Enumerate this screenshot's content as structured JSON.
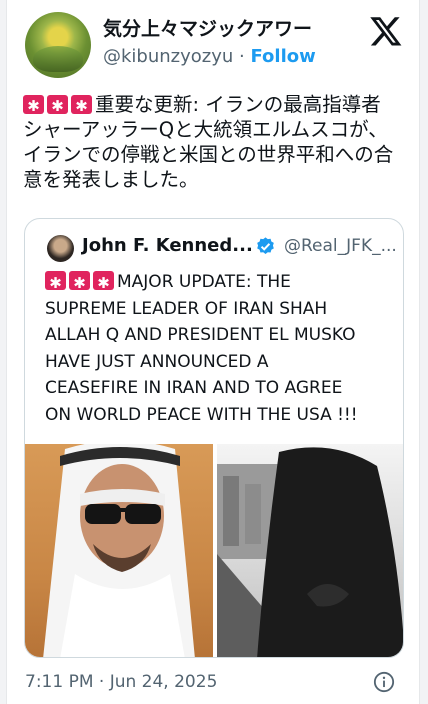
{
  "author": {
    "display_name": "気分上々マジックアワー",
    "handle": "@kibunzyozyu",
    "separator": " · ",
    "follow_label": "Follow"
  },
  "post": {
    "text": "重要な更新: イランの最高指導者\nシャーアッラーQと大統領エルムスコが、\nイランでの停戦と米国との世界平和への合\n意を発表しました。",
    "timestamp": "7:11 PM · Jun 24, 2025"
  },
  "quoted": {
    "display_name": "John F. Kenned...",
    "handle": "@Real_JFK_...",
    "text": "MAJOR UPDATE: THE\nSUPREME LEADER OF IRAN SHAH\nALLAH Q AND PRESIDENT EL MUSKO\nHAVE JUST ANNOUNCED A\nCEASEFIRE IN IRAN AND TO AGREE\nON WORLD PEACE WITH THE USA !!!"
  },
  "icons": {
    "brand": "x-logo-icon",
    "verified": "verified-badge-icon",
    "info": "info-icon",
    "emoji": "police-light-emoji"
  },
  "colors": {
    "link": "#1d9bf0",
    "verified": "#1d9bf0",
    "siren": "#e0245e",
    "muted": "#536471"
  }
}
